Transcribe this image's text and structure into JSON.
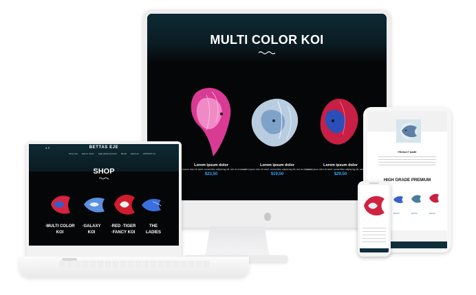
{
  "desktop": {
    "hero_title": "MULTI COLOR KOI",
    "products": [
      {
        "name": "Lorem ipsum dolor",
        "desc": "Lorem ipsum dolor sit amet, consectetur adipiscing elit, sed do eiusmod",
        "price": "$23,50",
        "color": "#e0409a"
      },
      {
        "name": "Lorem ipsum dolor",
        "desc": "Lorem ipsum dolor sit amet, consectetur adipiscing elit, sed do eiusmod",
        "price": "$19,50",
        "color": "#c9d6e6"
      },
      {
        "name": "Lorem ipsum dolor",
        "desc": "Lorem ipsum dolor sit amet, consectetur adipiscing elit, sed do eiusmod",
        "price": "$29,50",
        "color": "#d6264a"
      }
    ],
    "price_color": "#2ea9ff"
  },
  "laptop": {
    "brand": "BETTAS EJE",
    "menu": [
      "shop now",
      "How to maint.",
      "High grade premium",
      "BLOG",
      "About us",
      "CONTACT us"
    ],
    "page_title": "SHOP",
    "categories": [
      {
        "line1": "·MULTI COLOR",
        "line2": "KOI"
      },
      {
        "line1": "·GALAXY",
        "line2": "KOI"
      },
      {
        "line1": "·RED ·TIGER",
        "line2": "·FANCY KOI"
      },
      {
        "line1": "THE",
        "line2": "LADIES"
      }
    ]
  },
  "tablet": {
    "product_name": "PRODUCT NAME",
    "section_title": "HIGH GRADE PREMIUM",
    "prices": [
      "$23.50",
      "$19.50",
      "$29.50"
    ]
  },
  "colors": {
    "screen_dark": "#050607",
    "hero_teal": "#0e2a33",
    "device_frame": "#eeeeef"
  }
}
